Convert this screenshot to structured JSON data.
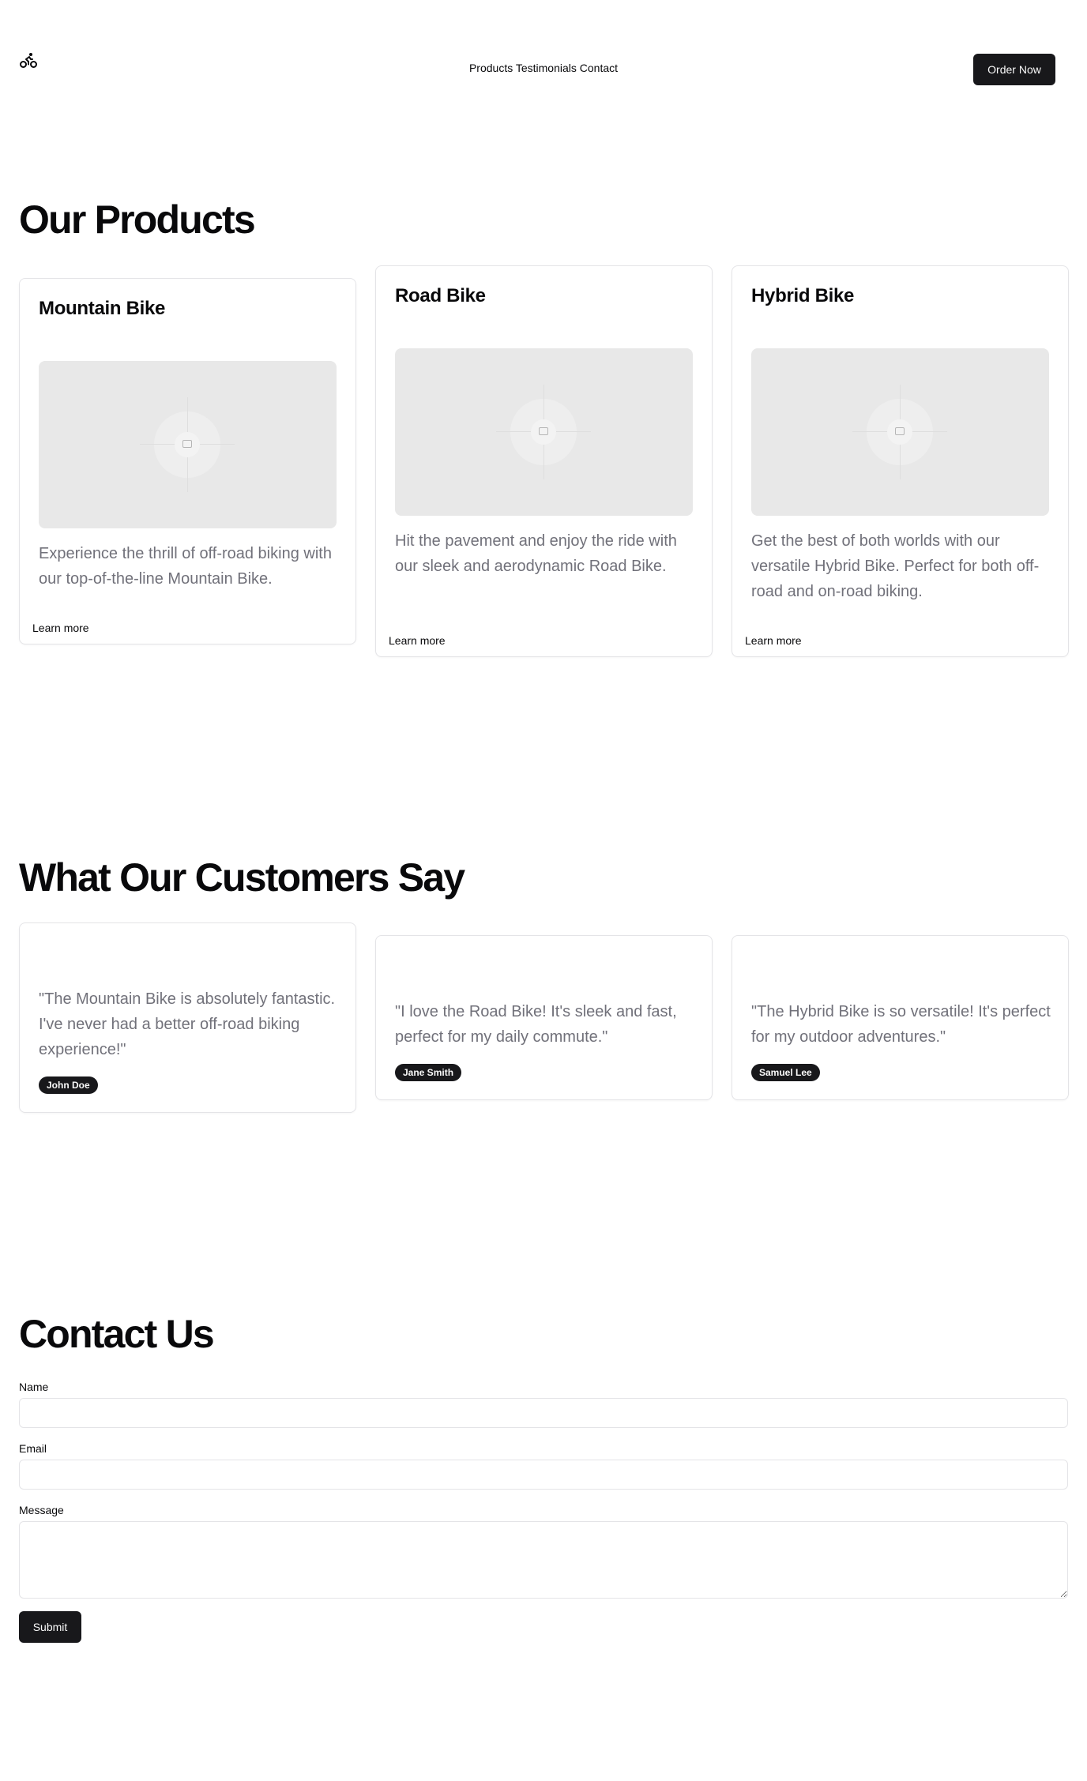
{
  "header": {
    "logo_icon": "bicycle-icon",
    "nav": [
      "Products",
      "Testimonials",
      "Contact"
    ],
    "order_button": "Order Now"
  },
  "products": {
    "heading": "Our Products",
    "items": [
      {
        "title": "Mountain Bike",
        "description": "Experience the thrill of off-road biking with our top-of-the-line Mountain Bike.",
        "link": "Learn more",
        "image_icon": "image-placeholder-icon"
      },
      {
        "title": "Road Bike",
        "description": "Hit the pavement and enjoy the ride with our sleek and aerodynamic Road Bike.",
        "link": "Learn more",
        "image_icon": "image-placeholder-icon"
      },
      {
        "title": "Hybrid Bike",
        "description": "Get the best of both worlds with our versatile Hybrid Bike. Perfect for both off-road and on-road biking.",
        "link": "Learn more",
        "image_icon": "image-placeholder-icon"
      }
    ]
  },
  "testimonials": {
    "heading": "What Our Customers Say",
    "items": [
      {
        "quote": "\"The Mountain Bike is absolutely fantastic. I've never had a better off-road biking experience!\"",
        "author": "John Doe"
      },
      {
        "quote": "\"I love the Road Bike! It's sleek and fast, perfect for my daily commute.\"",
        "author": "Jane Smith"
      },
      {
        "quote": "\"The Hybrid Bike is so versatile! It's perfect for my outdoor adventures.\"",
        "author": "Samuel Lee"
      }
    ]
  },
  "contact": {
    "heading": "Contact Us",
    "name_label": "Name",
    "name_value": "",
    "email_label": "Email",
    "email_value": "",
    "message_label": "Message",
    "message_value": "",
    "submit": "Submit"
  },
  "colors": {
    "primary": "#18181b",
    "muted_text": "#71717a",
    "border": "#e4e4e7",
    "placeholder_bg": "#e8e8e8"
  }
}
